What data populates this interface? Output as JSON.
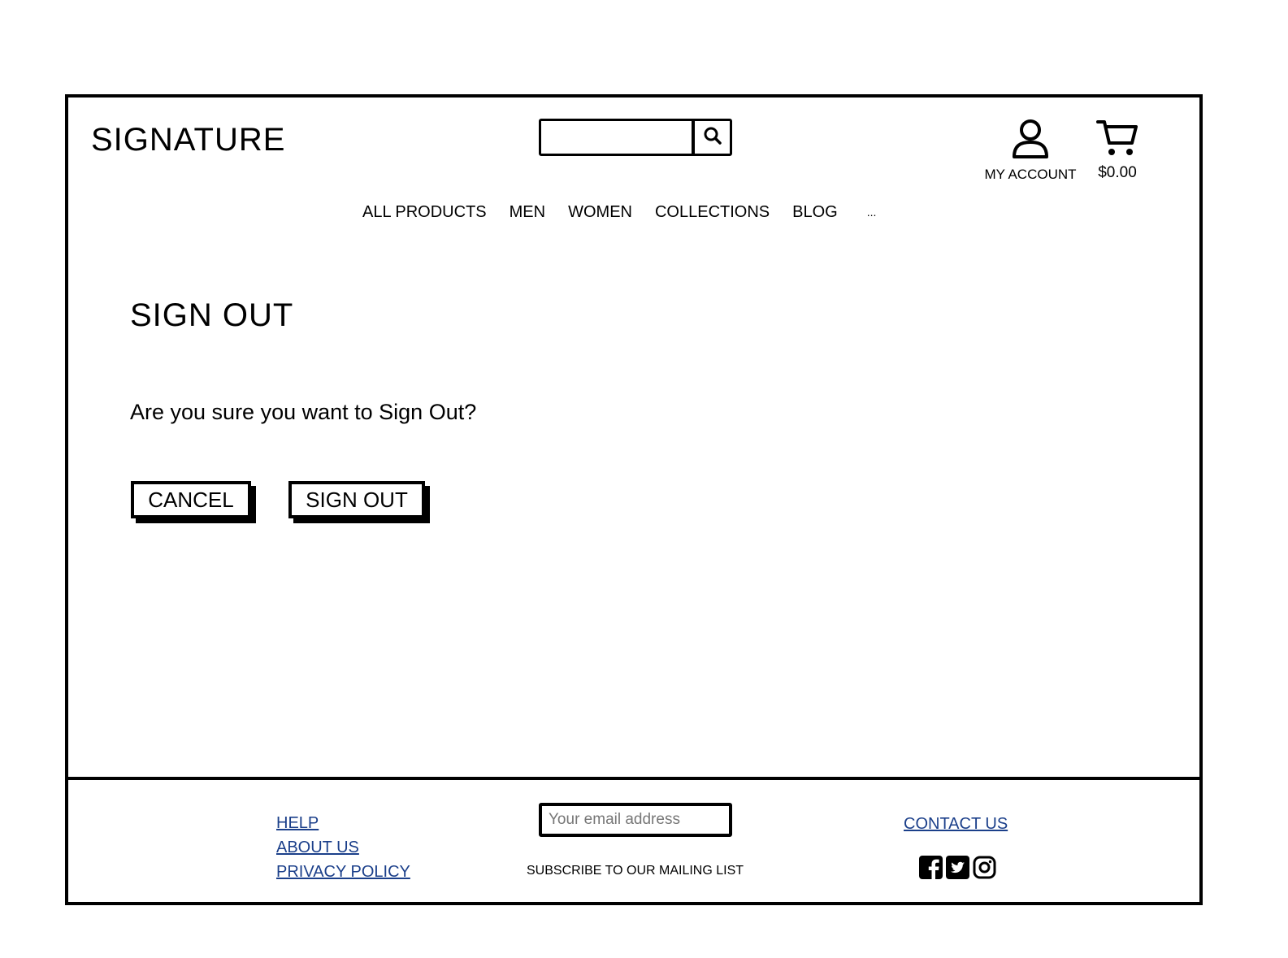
{
  "header": {
    "brand": "SIGNATURE",
    "search": {
      "placeholder": "",
      "icon": "search-icon"
    },
    "account": {
      "label": "MY ACCOUNT",
      "icon": "user-icon"
    },
    "cart": {
      "total": "$0.00",
      "icon": "cart-icon"
    }
  },
  "nav": {
    "items": [
      {
        "label": "ALL PRODUCTS"
      },
      {
        "label": "MEN"
      },
      {
        "label": "WOMEN"
      },
      {
        "label": "COLLECTIONS"
      },
      {
        "label": "BLOG"
      },
      {
        "label": "..."
      }
    ]
  },
  "main": {
    "title": "SIGN OUT",
    "question": "Are you sure you want to Sign Out?",
    "cancel_label": "CANCEL",
    "signout_label": "SIGN OUT"
  },
  "footer": {
    "links": [
      {
        "label": "HELP"
      },
      {
        "label": "ABOUT US"
      },
      {
        "label": "PRIVACY POLICY"
      }
    ],
    "email_placeholder": "Your email address",
    "subscribe_label": "SUBSCRIBE TO OUR MAILING LIST",
    "contact_label": "CONTACT US",
    "social": [
      "facebook-icon",
      "twitter-icon",
      "instagram-icon"
    ],
    "link_color": "#1b3f8a"
  }
}
